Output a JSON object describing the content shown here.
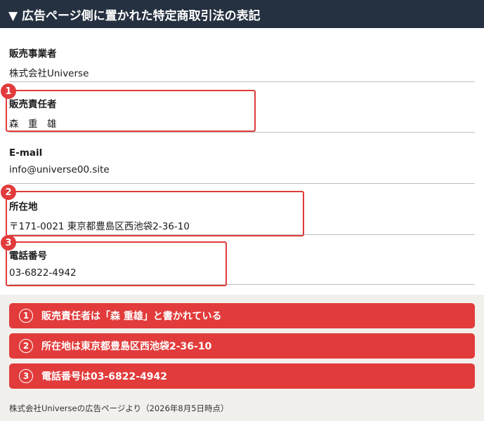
{
  "header": {
    "title": "▼ 広告ページ側に置かれた特定商取引法の表記"
  },
  "fields": [
    {
      "label": "販売事業者",
      "value": "株式会社Universe"
    },
    {
      "label": "販売責任者",
      "value": "森　重　雄"
    },
    {
      "label": "E-mail",
      "value": "info@universe00.site"
    },
    {
      "label": "所在地",
      "value": "〒171-0021 東京都豊島区西池袋2-36-10"
    },
    {
      "label": "電話番号",
      "value": "03-6822-4942"
    }
  ],
  "badges": [
    "1",
    "2",
    "3"
  ],
  "notes": [
    {
      "num": "1",
      "text": "販売責任者は「森 重雄」と書かれている"
    },
    {
      "num": "2",
      "text": "所在地は東京都豊島区西池袋2-36-10"
    },
    {
      "num": "3",
      "text": "電話番号は03-6822-4942"
    }
  ],
  "footer": {
    "source": "株式会社Universeの広告ページより（2026年8月5日時点）"
  },
  "colors": {
    "header_bg": "#253140",
    "accent_red": "#e23b3b",
    "panel_bg": "#ffffff",
    "page_bg": "#f1f0ec"
  }
}
